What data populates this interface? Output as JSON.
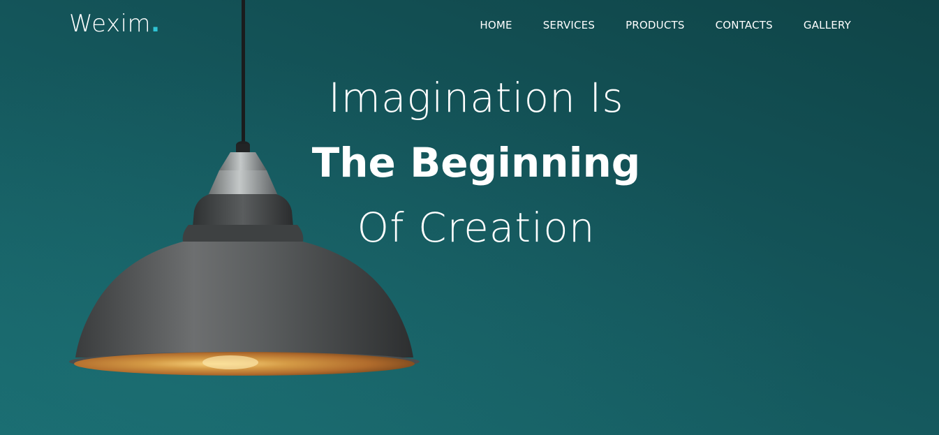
{
  "brand": {
    "name": "Wexim",
    "dot": ".",
    "accent_color": "#2fc3d4"
  },
  "nav": {
    "items": [
      {
        "label": "HOME"
      },
      {
        "label": "SERVICES"
      },
      {
        "label": "PRODUCTS"
      },
      {
        "label": "CONTACTS"
      },
      {
        "label": "GALLERY"
      }
    ]
  },
  "hero": {
    "line1": "Imagination Is",
    "line2": "The Beginning",
    "line3": "Of Creation",
    "background_color": "#14555a",
    "image": "pendant-lamp"
  }
}
